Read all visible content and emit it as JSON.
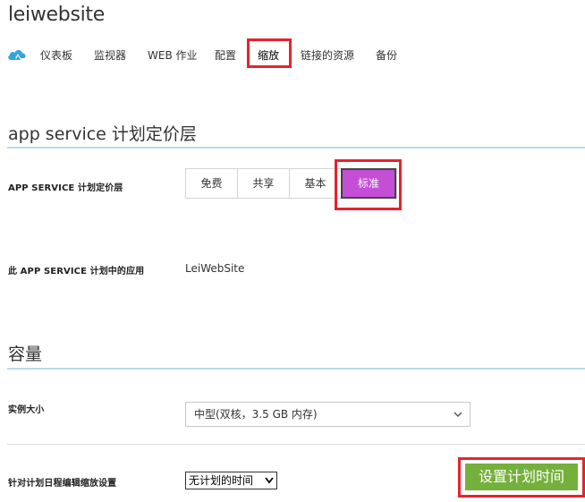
{
  "app_title": "leiwebsite",
  "nav": {
    "items": [
      "仪表板",
      "监视器",
      "WEB 作业",
      "配置",
      "缩放",
      "链接的资源",
      "备份"
    ],
    "active": "缩放"
  },
  "pricing": {
    "section_title": "app service 计划定价层",
    "tier_label": "APP SERVICE 计划定价层",
    "tiers": [
      "免费",
      "共享",
      "基本",
      "标准"
    ],
    "selected_tier": "标准",
    "apps_label": "此 APP SERVICE 计划中的应用",
    "apps_value": "LeiWebSite"
  },
  "capacity": {
    "section_title": "容量",
    "instance_size_label": "实例大小",
    "instance_size_value": "中型(双核，3.5 GB 内存)",
    "schedule_label": "针对计划日程编辑缩放设置",
    "schedule_value": "无计划的时间",
    "schedule_button": "设置计划时间"
  },
  "colors": {
    "accent_purple": "#c44fd6",
    "highlight_red": "#e8222c",
    "button_green": "#75b03c",
    "section_line": "#b9dbe8"
  },
  "icons": {
    "nav_logo": "azure-cloud-icon",
    "dropdown": "chevron-down-icon"
  }
}
